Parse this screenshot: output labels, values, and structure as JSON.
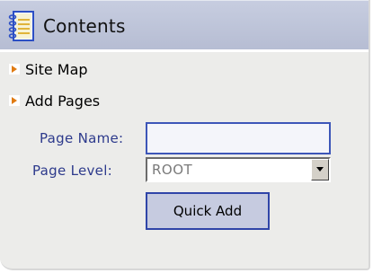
{
  "header": {
    "title": "Contents",
    "icon": "notebook-icon"
  },
  "nav": {
    "items": [
      {
        "label": "Site Map",
        "icon": "orange-arrow-icon"
      },
      {
        "label": "Add Pages",
        "icon": "orange-arrow-icon"
      }
    ]
  },
  "form": {
    "page_name_label": "Page Name:",
    "page_name_value": "",
    "page_level_label": "Page Level:",
    "page_level_value": "ROOT",
    "submit_label": "Quick Add"
  },
  "colors": {
    "header_bg": "#bcc3d8",
    "panel_bg": "#ececea",
    "label_text": "#2d3a8c",
    "accent_border": "#2f45a8",
    "arrow_orange": "#e07b12"
  }
}
